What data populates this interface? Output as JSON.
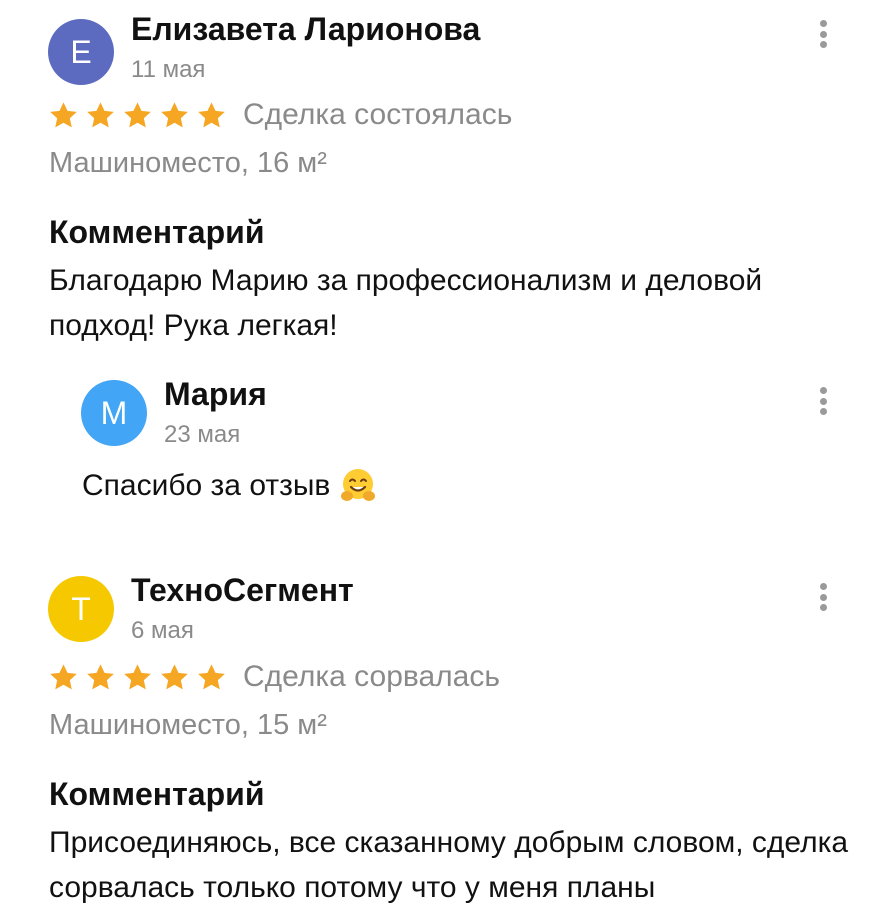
{
  "colors": {
    "star": "#f5a623",
    "muted_text": "#8a8a8a",
    "avatar_e": "#5c6bc0",
    "avatar_m": "#42a5f5",
    "avatar_t": "#f5c800"
  },
  "reviews": [
    {
      "avatar_letter": "E",
      "author": "Елизавета Ларионова",
      "date": "11 мая",
      "rating": 5,
      "deal_status": "Сделка состоялась",
      "subject": "Машиноместо, 16 м²",
      "comment_heading": "Комментарий",
      "comment_text": "Благодарю Марию за профессионализм и деловой подход! Рука легкая!",
      "reply": {
        "avatar_letter": "M",
        "author": "Мария",
        "date": "23 мая",
        "text": "Спасибо за отзыв",
        "emoji": "hugging-face-icon"
      }
    },
    {
      "avatar_letter": "T",
      "author": "ТехноСегмент",
      "date": "6 мая",
      "rating": 5,
      "deal_status": "Сделка сорвалась",
      "subject": "Машиноместо, 15 м²",
      "comment_heading": "Комментарий",
      "comment_text": "Присоединяюсь, все сказанному добрым словом, сделка сорвалась только потому что у меня планы"
    }
  ],
  "icons": [
    "star-icon",
    "more-vertical-icon",
    "hugging-face-icon"
  ]
}
